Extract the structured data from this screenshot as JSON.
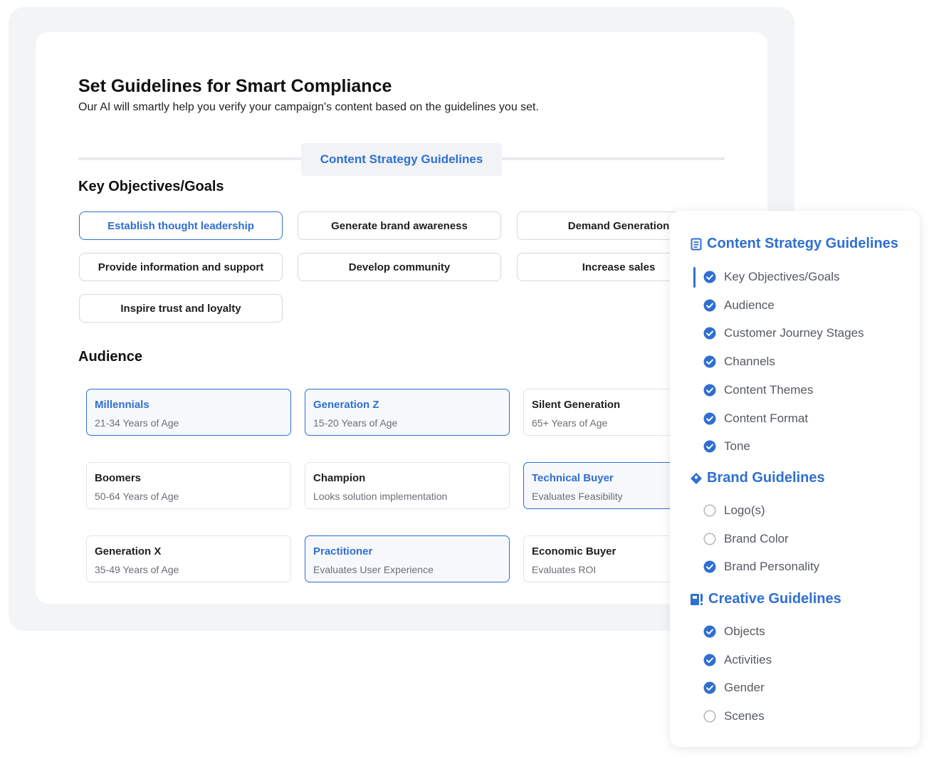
{
  "page": {
    "title": "Set Guidelines for Smart Compliance",
    "subtitle": "Our AI will smartly help you verify your campaign's content based on the guidelines you set.",
    "active_tab": "Content Strategy Guidelines"
  },
  "objectives": {
    "heading": "Key Objectives/Goals",
    "items": [
      {
        "label": "Establish thought leadership",
        "selected": true
      },
      {
        "label": "Generate brand awareness",
        "selected": false
      },
      {
        "label": "Demand Generation",
        "selected": false
      },
      {
        "label": "Provide information and support",
        "selected": false
      },
      {
        "label": "Develop community",
        "selected": false
      },
      {
        "label": "Increase sales",
        "selected": false
      },
      {
        "label": "Inspire trust and loyalty",
        "selected": false
      }
    ]
  },
  "audience": {
    "heading": "Audience",
    "items": [
      {
        "name": "Millennials",
        "desc": "21-34 Years of Age",
        "selected": true
      },
      {
        "name": "Generation Z",
        "desc": "15-20 Years of Age",
        "selected": true
      },
      {
        "name": "Silent Generation",
        "desc": "65+ Years of Age",
        "selected": false
      },
      {
        "name": "Boomers",
        "desc": "50-64 Years of Age",
        "selected": false
      },
      {
        "name": "Champion",
        "desc": "Looks solution implementation",
        "selected": false
      },
      {
        "name": "Technical Buyer",
        "desc": "Evaluates Feasibility",
        "selected": true
      },
      {
        "name": "Generation X",
        "desc": "35-49 Years of Age",
        "selected": false
      },
      {
        "name": "Practitioner",
        "desc": "Evaluates User Experience",
        "selected": true
      },
      {
        "name": "Economic Buyer",
        "desc": "Evaluates ROI",
        "selected": false
      }
    ]
  },
  "sidebar": {
    "sections": [
      {
        "title": "Content Strategy Guidelines",
        "icon": "document-icon",
        "items": [
          {
            "label": "Key Objectives/Goals",
            "checked": true,
            "active": true
          },
          {
            "label": "Audience",
            "checked": true
          },
          {
            "label": "Customer Journey Stages",
            "checked": true
          },
          {
            "label": "Channels",
            "checked": true
          },
          {
            "label": "Content Themes",
            "checked": true
          },
          {
            "label": "Content Format",
            "checked": true
          },
          {
            "label": "Tone",
            "checked": true
          }
        ]
      },
      {
        "title": "Brand Guidelines",
        "icon": "brand-badge-icon",
        "items": [
          {
            "label": "Logo(s)",
            "checked": false
          },
          {
            "label": "Brand Color",
            "checked": false
          },
          {
            "label": "Brand Personality",
            "checked": true
          }
        ]
      },
      {
        "title": "Creative Guidelines",
        "icon": "creative-book-icon",
        "items": [
          {
            "label": "Objects",
            "checked": true
          },
          {
            "label": "Activities",
            "checked": true
          },
          {
            "label": "Gender",
            "checked": true
          },
          {
            "label": "Scenes",
            "checked": false
          }
        ]
      }
    ]
  },
  "colors": {
    "accent": "#2f6fd1",
    "border": "#d6d8dd",
    "muted_text": "#6b6f76"
  }
}
